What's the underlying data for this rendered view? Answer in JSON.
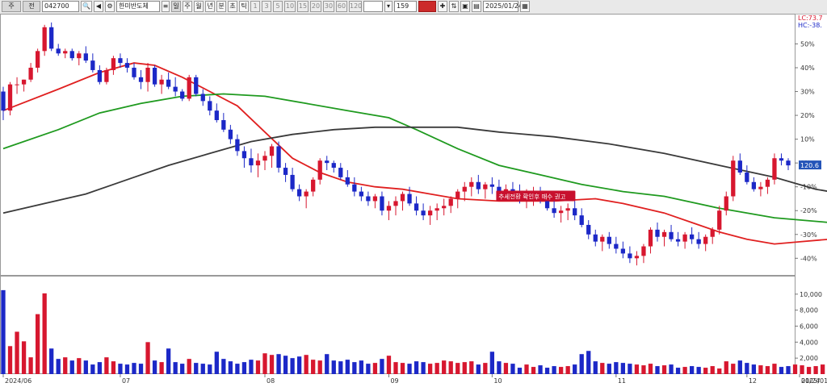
{
  "toolbar": {
    "items": [
      {
        "name": "toolbar-period-select",
        "label": "주",
        "kind": "sel",
        "w": 24
      },
      {
        "name": "toolbar-market-select",
        "label": "전",
        "kind": "sel",
        "w": 22
      },
      {
        "name": "toolbar-code-input",
        "label": "042700",
        "kind": "field",
        "w": 46
      },
      {
        "name": "toolbar-search-icon",
        "label": "🔍",
        "kind": "btn",
        "w": 14
      },
      {
        "name": "toolbar-sound-icon",
        "label": "◀",
        "kind": "btn",
        "w": 12
      },
      {
        "name": "toolbar-settings-icon",
        "label": "⚙",
        "kind": "btn",
        "w": 12
      },
      {
        "name": "toolbar-stock-name",
        "label": "한미반도체",
        "kind": "field",
        "w": 54
      },
      {
        "name": "toolbar-menu-icon",
        "label": "≡",
        "kind": "btn",
        "w": 10
      },
      {
        "name": "tab-day",
        "label": "일",
        "kind": "sel",
        "w": 12
      },
      {
        "name": "tab-week",
        "label": "주",
        "kind": "btn",
        "w": 12
      },
      {
        "name": "tab-month",
        "label": "월",
        "kind": "btn",
        "w": 12
      },
      {
        "name": "tab-year",
        "label": "년",
        "kind": "btn",
        "w": 12
      },
      {
        "name": "tab-minute",
        "label": "분",
        "kind": "btn",
        "w": 12
      },
      {
        "name": "tab-second",
        "label": "초",
        "kind": "btn",
        "w": 12
      },
      {
        "name": "tab-tick",
        "label": "틱",
        "kind": "btn",
        "w": 12
      },
      {
        "name": "interval-1",
        "label": "1",
        "kind": "grey",
        "w": 12
      },
      {
        "name": "interval-3",
        "label": "3",
        "kind": "grey",
        "w": 12
      },
      {
        "name": "interval-5",
        "label": "5",
        "kind": "grey",
        "w": 12
      },
      {
        "name": "interval-10",
        "label": "10",
        "kind": "grey",
        "w": 14
      },
      {
        "name": "interval-15",
        "label": "15",
        "kind": "grey",
        "w": 14
      },
      {
        "name": "interval-20",
        "label": "20",
        "kind": "grey",
        "w": 14
      },
      {
        "name": "interval-30",
        "label": "30",
        "kind": "grey",
        "w": 14
      },
      {
        "name": "interval-60",
        "label": "60",
        "kind": "grey",
        "w": 14
      },
      {
        "name": "interval-120",
        "label": "120",
        "kind": "grey",
        "w": 16
      },
      {
        "name": "interval-custom-input",
        "label": "",
        "kind": "field",
        "w": 24
      },
      {
        "name": "interval-dropdown",
        "label": "▾",
        "kind": "btn",
        "w": 10
      },
      {
        "name": "count-input",
        "label": "159",
        "kind": "field",
        "w": 28
      },
      {
        "name": "count-apply-button",
        "label": "",
        "kind": "accent",
        "w": 22
      },
      {
        "name": "toolbar-crosshair-icon",
        "label": "✚",
        "kind": "btn",
        "w": 12
      },
      {
        "name": "toolbar-chart-icon",
        "label": "⇅",
        "kind": "btn",
        "w": 12
      },
      {
        "name": "toolbar-save-icon",
        "label": "▣",
        "kind": "btn",
        "w": 12
      },
      {
        "name": "toolbar-chart-type-icon",
        "label": "▤",
        "kind": "btn",
        "w": 12
      },
      {
        "name": "toolbar-date-input",
        "label": "2025/01/24",
        "kind": "field",
        "w": 44
      },
      {
        "name": "toolbar-calendar-icon",
        "label": "▦",
        "kind": "btn",
        "w": 12
      }
    ]
  },
  "colors": {
    "up": "#d7172f",
    "down": "#1c28c7",
    "ma_short": "#e02020",
    "ma_mid": "#1f9a1f",
    "ma_long": "#3a3a3a",
    "label_box": "#c8102e",
    "last_price_box": "#2454b8"
  },
  "chart_data": {
    "type": "candlestick",
    "y_axis_unit": "%",
    "price_axis": {
      "ticks": [
        "50%",
        "40%",
        "30%",
        "20%",
        "10%",
        "0%",
        "-10%",
        "-20%",
        "-30%",
        "-40%"
      ],
      "range": [
        -47,
        62
      ]
    },
    "volume_axis": {
      "ticks": [
        "10,000",
        "8,000",
        "6,000",
        "4,000",
        "2,000"
      ],
      "range": [
        0,
        12000
      ]
    },
    "x_ticks": [
      {
        "label": "2024/06",
        "index": 0
      },
      {
        "label": "07",
        "index": 17
      },
      {
        "label": "08",
        "index": 38
      },
      {
        "label": "09",
        "index": 56
      },
      {
        "label": "10",
        "index": 71
      },
      {
        "label": "11",
        "index": 89
      },
      {
        "label": "12",
        "index": 108
      },
      {
        "label": "2025/01",
        "index": 126
      },
      {
        "label": "01/24",
        "index": 144
      }
    ],
    "markers": {
      "lc": "LC:73.7",
      "hc": "HC:-38.",
      "last_price": "120.6"
    },
    "annotation": {
      "text": "추세전환 확인후 매수 권고",
      "index": 73,
      "value": -14
    },
    "moving_averages": [
      {
        "key": "ma_short",
        "points": [
          [
            0,
            22
          ],
          [
            8,
            31
          ],
          [
            14,
            38
          ],
          [
            19,
            42
          ],
          [
            22,
            41
          ],
          [
            26,
            36
          ],
          [
            30,
            30
          ],
          [
            34,
            24
          ],
          [
            38,
            13
          ],
          [
            42,
            2
          ],
          [
            46,
            -4
          ],
          [
            50,
            -8
          ],
          [
            54,
            -10
          ],
          [
            58,
            -11
          ],
          [
            62,
            -13
          ],
          [
            66,
            -15
          ],
          [
            72,
            -16
          ],
          [
            80,
            -16
          ],
          [
            86,
            -15
          ],
          [
            90,
            -17
          ],
          [
            96,
            -21
          ],
          [
            100,
            -25
          ],
          [
            104,
            -29
          ],
          [
            108,
            -32
          ],
          [
            112,
            -34
          ],
          [
            116,
            -33
          ],
          [
            120,
            -32
          ],
          [
            124,
            -30
          ],
          [
            128,
            -26
          ],
          [
            132,
            -22
          ],
          [
            136,
            -19
          ],
          [
            139,
            -14
          ]
        ]
      },
      {
        "key": "ma_mid",
        "points": [
          [
            0,
            6
          ],
          [
            8,
            14
          ],
          [
            14,
            21
          ],
          [
            20,
            25
          ],
          [
            26,
            28
          ],
          [
            32,
            29
          ],
          [
            38,
            28
          ],
          [
            44,
            25
          ],
          [
            50,
            22
          ],
          [
            56,
            19
          ],
          [
            60,
            14
          ],
          [
            66,
            6
          ],
          [
            72,
            -1
          ],
          [
            78,
            -5
          ],
          [
            84,
            -9
          ],
          [
            90,
            -12
          ],
          [
            96,
            -14
          ],
          [
            104,
            -19
          ],
          [
            112,
            -23
          ],
          [
            120,
            -25
          ],
          [
            128,
            -27
          ],
          [
            134,
            -26
          ],
          [
            138,
            -25
          ]
        ]
      },
      {
        "key": "ma_long",
        "points": [
          [
            0,
            -21
          ],
          [
            6,
            -17
          ],
          [
            12,
            -13
          ],
          [
            18,
            -7
          ],
          [
            24,
            -1
          ],
          [
            30,
            4
          ],
          [
            36,
            9
          ],
          [
            42,
            12
          ],
          [
            48,
            14
          ],
          [
            54,
            15
          ],
          [
            60,
            15
          ],
          [
            66,
            15
          ],
          [
            72,
            13
          ],
          [
            80,
            11
          ],
          [
            88,
            8
          ],
          [
            96,
            4
          ],
          [
            104,
            -1
          ],
          [
            112,
            -6
          ],
          [
            118,
            -11
          ],
          [
            124,
            -14
          ],
          [
            130,
            -16
          ],
          [
            134,
            -17
          ],
          [
            139,
            -18
          ]
        ]
      }
    ],
    "candles": [
      [
        30,
        32,
        18,
        22
      ],
      [
        22,
        34,
        20,
        33
      ],
      [
        33,
        36,
        29,
        33
      ],
      [
        33,
        35,
        30,
        35
      ],
      [
        35,
        42,
        34,
        40
      ],
      [
        40,
        48,
        38,
        47
      ],
      [
        47,
        58,
        45,
        57
      ],
      [
        57,
        59,
        47,
        48
      ],
      [
        48,
        50,
        45,
        46
      ],
      [
        46,
        48,
        44,
        47
      ],
      [
        47,
        48,
        43,
        44
      ],
      [
        44,
        47,
        41,
        46
      ],
      [
        46,
        49,
        42,
        43
      ],
      [
        43,
        46,
        38,
        39
      ],
      [
        39,
        41,
        33,
        34
      ],
      [
        34,
        40,
        33,
        39
      ],
      [
        39,
        45,
        37,
        44
      ],
      [
        44,
        46,
        40,
        42
      ],
      [
        42,
        44,
        38,
        40
      ],
      [
        40,
        42,
        35,
        36
      ],
      [
        36,
        39,
        31,
        34
      ],
      [
        34,
        42,
        30,
        40
      ],
      [
        40,
        41,
        32,
        33
      ],
      [
        33,
        37,
        29,
        35
      ],
      [
        35,
        38,
        31,
        32
      ],
      [
        32,
        36,
        28,
        30
      ],
      [
        30,
        31,
        26,
        27
      ],
      [
        27,
        37,
        26,
        36
      ],
      [
        36,
        37,
        28,
        29
      ],
      [
        29,
        31,
        24,
        26
      ],
      [
        26,
        28,
        20,
        22
      ],
      [
        22,
        25,
        17,
        18
      ],
      [
        18,
        21,
        13,
        14
      ],
      [
        14,
        16,
        8,
        10
      ],
      [
        10,
        12,
        3,
        5
      ],
      [
        5,
        7,
        -2,
        2
      ],
      [
        2,
        6,
        -4,
        -1
      ],
      [
        -1,
        4,
        -6,
        1
      ],
      [
        1,
        5,
        -3,
        3
      ],
      [
        3,
        8,
        -2,
        7
      ],
      [
        7,
        9,
        -4,
        -2
      ],
      [
        -2,
        0,
        -8,
        -5
      ],
      [
        -5,
        -2,
        -12,
        -11
      ],
      [
        -11,
        -9,
        -16,
        -14
      ],
      [
        -14,
        -11,
        -19,
        -12
      ],
      [
        -12,
        -6,
        -14,
        -7
      ],
      [
        -7,
        2,
        -9,
        1
      ],
      [
        1,
        3,
        -3,
        0
      ],
      [
        0,
        1,
        -4,
        -2
      ],
      [
        -2,
        0,
        -7,
        -6
      ],
      [
        -6,
        -3,
        -10,
        -9
      ],
      [
        -9,
        -6,
        -14,
        -12
      ],
      [
        -12,
        -10,
        -16,
        -14
      ],
      [
        -14,
        -12,
        -18,
        -16
      ],
      [
        -16,
        -13,
        -19,
        -14
      ],
      [
        -14,
        -12,
        -22,
        -20
      ],
      [
        -20,
        -16,
        -24,
        -18
      ],
      [
        -18,
        -14,
        -22,
        -16
      ],
      [
        -16,
        -12,
        -20,
        -13
      ],
      [
        -13,
        -10,
        -18,
        -17
      ],
      [
        -17,
        -14,
        -22,
        -20
      ],
      [
        -20,
        -17,
        -24,
        -22
      ],
      [
        -22,
        -18,
        -26,
        -20
      ],
      [
        -20,
        -17,
        -24,
        -19
      ],
      [
        -19,
        -15,
        -22,
        -18
      ],
      [
        -18,
        -14,
        -21,
        -15
      ],
      [
        -15,
        -11,
        -19,
        -12
      ],
      [
        -12,
        -8,
        -16,
        -10
      ],
      [
        -10,
        -6,
        -14,
        -8
      ],
      [
        -8,
        -5,
        -13,
        -11
      ],
      [
        -11,
        -8,
        -15,
        -9
      ],
      [
        -9,
        -6,
        -13,
        -10
      ],
      [
        -10,
        -7,
        -15,
        -12
      ],
      [
        -12,
        -9,
        -16,
        -11
      ],
      [
        -11,
        -8,
        -15,
        -13
      ],
      [
        -13,
        -9,
        -17,
        -15
      ],
      [
        -15,
        -11,
        -19,
        -14
      ],
      [
        -14,
        -10,
        -18,
        -13
      ],
      [
        -13,
        -10,
        -17,
        -16
      ],
      [
        -16,
        -13,
        -20,
        -19
      ],
      [
        -19,
        -16,
        -23,
        -21
      ],
      [
        -21,
        -18,
        -25,
        -20
      ],
      [
        -20,
        -17,
        -24,
        -19
      ],
      [
        -19,
        -16,
        -24,
        -22
      ],
      [
        -22,
        -19,
        -27,
        -26
      ],
      [
        -26,
        -24,
        -32,
        -30
      ],
      [
        -30,
        -28,
        -35,
        -33
      ],
      [
        -33,
        -30,
        -37,
        -31
      ],
      [
        -31,
        -29,
        -36,
        -34
      ],
      [
        -34,
        -31,
        -38,
        -36
      ],
      [
        -36,
        -33,
        -40,
        -38
      ],
      [
        -38,
        -35,
        -42,
        -40
      ],
      [
        -40,
        -37,
        -43,
        -39
      ],
      [
        -39,
        -34,
        -42,
        -35
      ],
      [
        -35,
        -27,
        -38,
        -28
      ],
      [
        -28,
        -25,
        -33,
        -31
      ],
      [
        -31,
        -28,
        -35,
        -29
      ],
      [
        -29,
        -26,
        -33,
        -32
      ],
      [
        -32,
        -29,
        -35,
        -33
      ],
      [
        -33,
        -29,
        -36,
        -30
      ],
      [
        -30,
        -27,
        -34,
        -32
      ],
      [
        -32,
        -29,
        -36,
        -34
      ],
      [
        -34,
        -30,
        -37,
        -31
      ],
      [
        -31,
        -27,
        -34,
        -28
      ],
      [
        -28,
        -18,
        -30,
        -20
      ],
      [
        -20,
        -12,
        -22,
        -14
      ],
      [
        -14,
        3,
        -16,
        1
      ],
      [
        1,
        4,
        -5,
        -4
      ],
      [
        -4,
        -1,
        -9,
        -8
      ],
      [
        -8,
        -6,
        -12,
        -11
      ],
      [
        -11,
        -8,
        -14,
        -10
      ],
      [
        -10,
        -6,
        -13,
        -7
      ],
      [
        -7,
        4,
        -9,
        2
      ],
      [
        2,
        4,
        -1,
        1
      ],
      [
        1,
        2,
        -3,
        -1
      ]
    ],
    "volume": [
      10500,
      3500,
      5300,
      4100,
      2100,
      7500,
      10100,
      3200,
      1900,
      2100,
      1700,
      2000,
      1700,
      1200,
      1500,
      2100,
      1600,
      1300,
      1200,
      1400,
      1300,
      4000,
      1700,
      1500,
      3200,
      1500,
      1300,
      1900,
      1400,
      1300,
      1200,
      2800,
      1900,
      1600,
      1300,
      1500,
      1800,
      1700,
      2600,
      2400,
      2500,
      2300,
      2000,
      2200,
      2400,
      1800,
      1700,
      2500,
      1700,
      1600,
      1800,
      1500,
      1700,
      1300,
      1400,
      1900,
      2300,
      1500,
      1400,
      1300,
      1600,
      1500,
      1300,
      1400,
      1700,
      1600,
      1400,
      1500,
      1600,
      1200,
      1400,
      2800,
      1600,
      1400,
      1300,
      800,
      1200,
      900,
      1100,
      800,
      1000,
      900,
      1000,
      1200,
      2500,
      2900,
      1600,
      1400,
      1300,
      1500,
      1400,
      1300,
      1200,
      1100,
      1300,
      1000,
      1100,
      1200,
      800,
      900,
      1000,
      900,
      800,
      1000,
      700,
      1600,
      1300,
      1700,
      1400,
      1200,
      1100,
      1000,
      1300,
      900,
      1000,
      1200,
      1100,
      900,
      1000,
      1200,
      1600,
      1200,
      1300,
      1000,
      2500,
      3500,
      4000,
      3600,
      2500,
      2000,
      1500,
      1400,
      1200,
      1300,
      1900,
      1100,
      4300,
      2000,
      1300
    ]
  }
}
